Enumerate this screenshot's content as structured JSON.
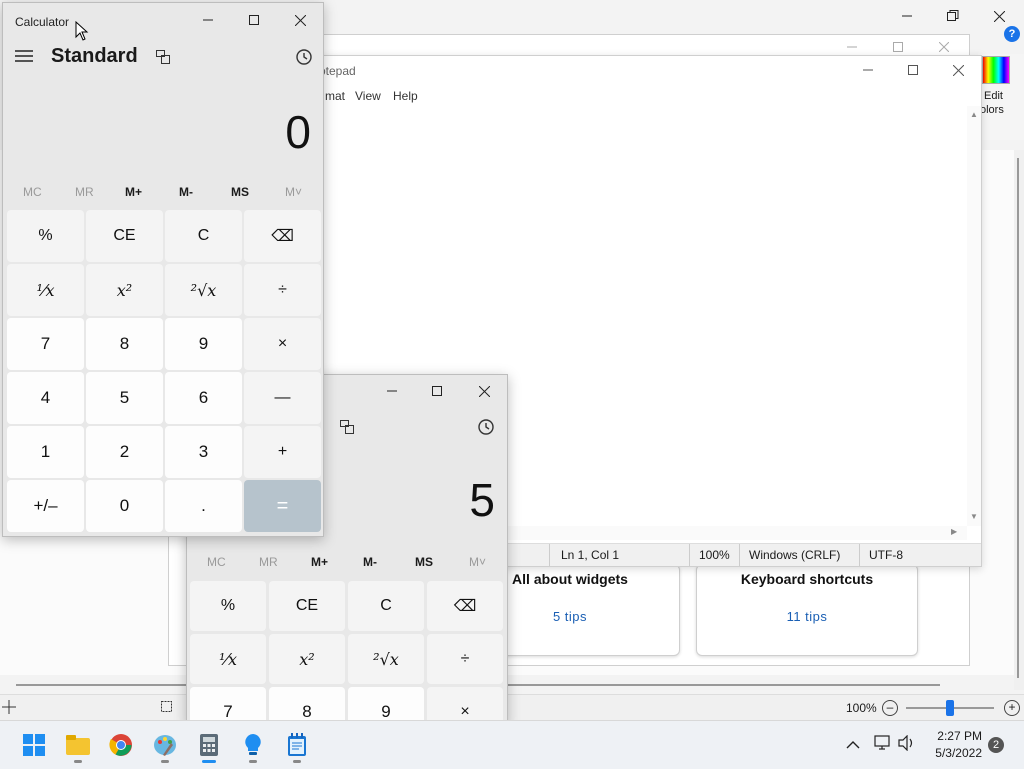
{
  "paint": {
    "edit_colors_label_1": "Edit",
    "edit_colors_label_2": "olors",
    "zoom": "100%",
    "colors": {
      "accent": "#1a73e8"
    }
  },
  "tips": {
    "card1_title": "All about widgets",
    "card1_sub": "5 tips",
    "card2_title": "Keyboard shortcuts",
    "card2_sub": "11 tips"
  },
  "notepad": {
    "title": "otepad",
    "menu": [
      "mat",
      "View",
      "Help"
    ],
    "status": {
      "position": "Ln 1, Col 1",
      "zoom": "100%",
      "line_ending": "Windows (CRLF)",
      "encoding": "UTF-8"
    }
  },
  "calc1": {
    "title": "Calculator",
    "mode": "Standard",
    "display": "0",
    "memory": [
      "MC",
      "MR",
      "M+",
      "M-",
      "MS",
      "M˅"
    ],
    "keys": [
      [
        "%",
        "CE",
        "C",
        "⌫"
      ],
      [
        "¹⁄x",
        "x²",
        "²√x",
        "÷"
      ],
      [
        "7",
        "8",
        "9",
        "×"
      ],
      [
        "4",
        "5",
        "6",
        "—"
      ],
      [
        "1",
        "2",
        "3",
        "+"
      ],
      [
        "+/–",
        "0",
        ".",
        "="
      ]
    ]
  },
  "calc2": {
    "display": "5",
    "memory": [
      "MC",
      "MR",
      "M+",
      "M-",
      "MS",
      "M˅"
    ],
    "keys": [
      [
        "%",
        "CE",
        "C",
        "⌫"
      ],
      [
        "¹⁄x",
        "x²",
        "²√x",
        "÷"
      ],
      [
        "7",
        "8",
        "9",
        "×"
      ]
    ]
  },
  "taskbar": {
    "time": "2:27 PM",
    "date": "5/3/2022",
    "notifications": "2"
  }
}
